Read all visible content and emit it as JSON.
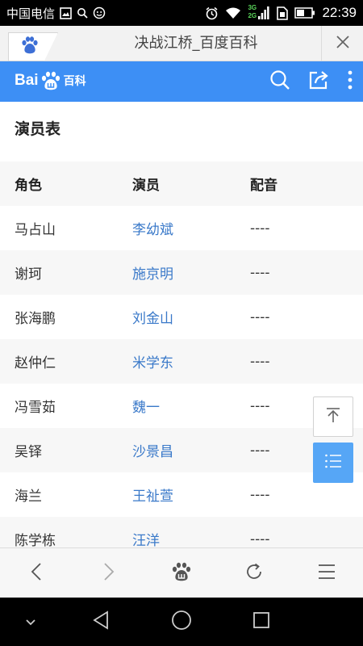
{
  "status_bar": {
    "carrier": "中国电信",
    "time": "22:39",
    "signal_labels": [
      "3G",
      "2G"
    ]
  },
  "tab": {
    "title": "决战江桥_百度百科"
  },
  "header": {
    "logo_bai": "Bai",
    "logo_baike": "百科",
    "accent_color": "#3d8ff5"
  },
  "section": {
    "title": "演员表"
  },
  "table": {
    "columns": [
      "角色",
      "演员",
      "配音"
    ],
    "rows": [
      {
        "role": "马占山",
        "actor": "李幼斌",
        "voice": "----"
      },
      {
        "role": "谢珂",
        "actor": "施京明",
        "voice": "----"
      },
      {
        "role": "张海鹏",
        "actor": "刘金山",
        "voice": "----"
      },
      {
        "role": "赵仲仁",
        "actor": "米学东",
        "voice": "----"
      },
      {
        "role": "冯雪茹",
        "actor": "魏一",
        "voice": "----"
      },
      {
        "role": "吴铎",
        "actor": "沙景昌",
        "voice": "----"
      },
      {
        "role": "海兰",
        "actor": "王祉萱",
        "voice": "----"
      },
      {
        "role": "陈学栋",
        "actor": "汪洋",
        "voice": "----"
      }
    ]
  },
  "icons": {
    "header": [
      "search-icon",
      "share-icon",
      "more-vertical-icon"
    ],
    "toolbar": [
      "back-icon",
      "forward-icon",
      "baidu-paw-icon",
      "refresh-icon",
      "menu-icon"
    ],
    "floating": [
      "back-to-top-icon",
      "toc-list-icon"
    ]
  }
}
